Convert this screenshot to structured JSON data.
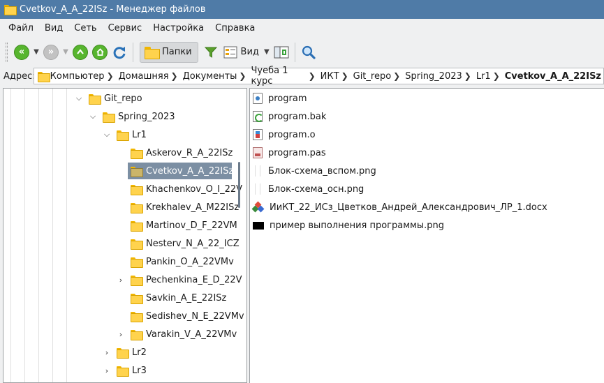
{
  "window": {
    "title": "Cvetkov_A_A_22ISz - Менеджер файлов"
  },
  "menu": [
    "Файл",
    "Вид",
    "Сеть",
    "Сервис",
    "Настройка",
    "Справка"
  ],
  "toolbar": {
    "folders_label": "Папки",
    "view_label": "Вид"
  },
  "address": {
    "label": "Адрес:",
    "crumbs": [
      "Компьютер",
      "Домашняя",
      "Документы",
      "Чуеба 1 курс",
      "ИКТ",
      "Git_repo",
      "Spring_2023",
      "Lr1",
      "Cvetkov_A_A_22ISz"
    ]
  },
  "tree": [
    {
      "label": "Git_repo",
      "expander": "open"
    },
    {
      "label": "Spring_2023",
      "expander": "open"
    },
    {
      "label": "Lr1",
      "expander": "open"
    },
    {
      "label": "Askerov_R_A_22ISz",
      "expander": ""
    },
    {
      "label": "Cvetkov_A_A_22ISz",
      "expander": "",
      "selected": true
    },
    {
      "label": "Khachenkov_O_I_22V",
      "expander": ""
    },
    {
      "label": "Krekhalev_A_M22ISz",
      "expander": ""
    },
    {
      "label": "Martinov_D_F_22VM",
      "expander": ""
    },
    {
      "label": "Nesterv_N_A_22_ICZ",
      "expander": ""
    },
    {
      "label": "Pankin_O_A_22VMv",
      "expander": ""
    },
    {
      "label": "Pechenkina_E_D_22V",
      "expander": "closed"
    },
    {
      "label": "Savkin_A_E_22ISz",
      "expander": ""
    },
    {
      "label": "Sedishev_N_E_22VMv",
      "expander": ""
    },
    {
      "label": "Varakin_V_A_22VMv",
      "expander": "closed"
    },
    {
      "label": "Lr2",
      "expander": "closed"
    },
    {
      "label": "Lr3",
      "expander": "closed"
    }
  ],
  "files": [
    {
      "name": "program",
      "icon": "executable-icon"
    },
    {
      "name": "program.bak",
      "icon": "backup-file-icon"
    },
    {
      "name": "program.o",
      "icon": "object-file-icon"
    },
    {
      "name": "program.pas",
      "icon": "pascal-file-icon"
    },
    {
      "name": "Блок-схема_вспом.png",
      "icon": "image-file-icon"
    },
    {
      "name": "Блок-схема_осн.png",
      "icon": "image-file-icon"
    },
    {
      "name": "ИиКТ_22_ИСз_Цветков_Андрей_Александрович_ЛР_1.docx",
      "icon": "docx-file-icon"
    },
    {
      "name": "пример выполнения программы.png",
      "icon": "black-image-icon"
    }
  ]
}
